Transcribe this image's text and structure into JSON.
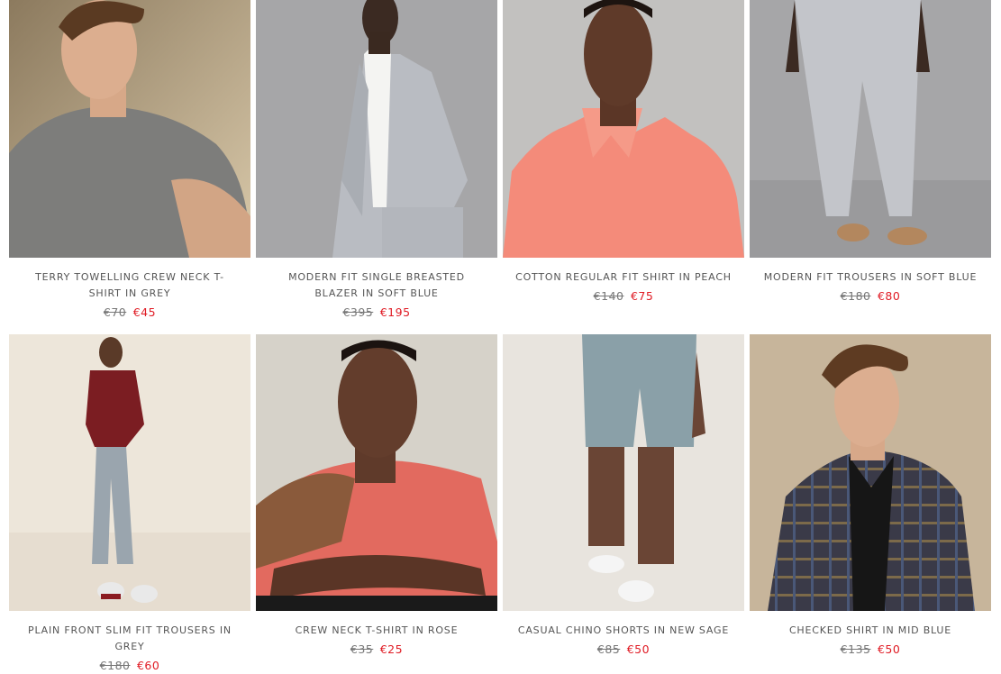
{
  "products": [
    {
      "title": "TERRY TOWELLING CREW NECK T-SHIRT IN GREY",
      "old_price": "€70",
      "new_price": "€45",
      "image": "model-grey-tshirt"
    },
    {
      "title": "MODERN FIT SINGLE BREASTED BLAZER IN SOFT BLUE",
      "old_price": "€395",
      "new_price": "€195",
      "image": "model-check-blazer"
    },
    {
      "title": "COTTON REGULAR FIT SHIRT IN PEACH",
      "old_price": "€140",
      "new_price": "€75",
      "image": "model-peach-shirt"
    },
    {
      "title": "MODERN FIT TROUSERS IN SOFT BLUE",
      "old_price": "€180",
      "new_price": "€80",
      "image": "model-check-trousers"
    },
    {
      "title": "PLAIN FRONT SLIM FIT TROUSERS IN GREY",
      "old_price": "€180",
      "new_price": "€60",
      "image": "model-grey-trousers"
    },
    {
      "title": "CREW NECK T-SHIRT IN ROSE",
      "old_price": "€35",
      "new_price": "€25",
      "image": "model-rose-tshirt"
    },
    {
      "title": "CASUAL CHINO SHORTS IN NEW SAGE",
      "old_price": "€85",
      "new_price": "€50",
      "image": "model-sage-shorts"
    },
    {
      "title": "CHECKED SHIRT IN MID BLUE",
      "old_price": "€135",
      "new_price": "€50",
      "image": "model-checked-shirt"
    }
  ],
  "colors": {
    "sale_price": "#e01b24",
    "old_price": "#777777",
    "title": "#555555"
  }
}
